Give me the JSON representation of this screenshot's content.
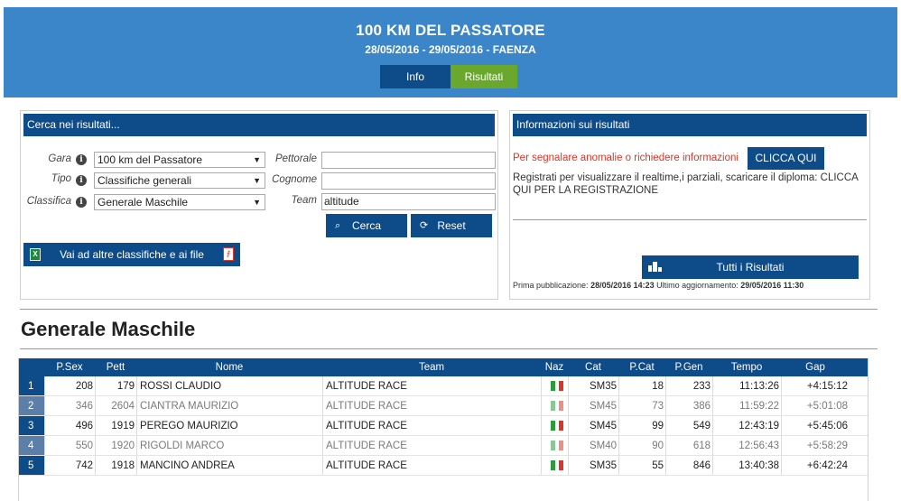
{
  "header": {
    "title": "100 KM DEL PASSATORE",
    "subtitle": "28/05/2016 - 29/05/2016 - FAENZA",
    "tabs": [
      {
        "label": "Info"
      },
      {
        "label": "Risultati"
      }
    ]
  },
  "search": {
    "heading": "Cerca nei risultati...",
    "gara_label": "Gara",
    "gara_value": "100 km del Passatore",
    "tipo_label": "Tipo",
    "tipo_value": "Classifiche generali",
    "classifica_label": "Classifica",
    "classifica_value": "Generale Maschile",
    "pettorale_label": "Pettorale",
    "pettorale_value": "",
    "cognome_label": "Cognome",
    "cognome_value": "",
    "team_label": "Team",
    "team_value": "altitude",
    "cerca_label": "Cerca",
    "reset_label": "Reset",
    "files_label": "Vai ad altre classifiche e ai file"
  },
  "info": {
    "heading": "Informazioni sui risultati",
    "warning": "Per segnalare anomalie o richiedere informazioni",
    "click_label": "CLICCA QUI",
    "register_text": "Registrati per visualizzare il realtime,i parziali, scaricare il diploma: CLICCA QUI PER LA REGISTRAZIONE",
    "all_results_label": "Tutti i Risultati",
    "first_pub_label": "Prima pubblicazione:",
    "first_pub_value": "28/05/2016 14:23",
    "last_update_label": "Ultimo aggiornamento:",
    "last_update_value": "29/05/2016 11:30"
  },
  "section": {
    "title": "Generale Maschile"
  },
  "table": {
    "columns": [
      "P.Sex",
      "Pett",
      "Nome",
      "Team",
      "Naz",
      "Cat",
      "P.Cat",
      "P.Gen",
      "Tempo",
      "Gap"
    ],
    "rows": [
      {
        "rank": "1",
        "psex": "208",
        "pett": "179",
        "nome": "ROSSI CLAUDIO",
        "team": "ALTITUDE RACE",
        "cat": "SM35",
        "pcat": "18",
        "pgen": "233",
        "tempo": "11:13:26",
        "gap": "+4:15:12"
      },
      {
        "rank": "2",
        "psex": "346",
        "pett": "2604",
        "nome": "CIANTRA MAURIZIO",
        "team": "ALTITUDE RACE",
        "cat": "SM45",
        "pcat": "73",
        "pgen": "386",
        "tempo": "11:59:22",
        "gap": "+5:01:08"
      },
      {
        "rank": "3",
        "psex": "496",
        "pett": "1919",
        "nome": "PEREGO MAURIZIO",
        "team": "ALTITUDE RACE",
        "cat": "SM45",
        "pcat": "99",
        "pgen": "549",
        "tempo": "12:43:19",
        "gap": "+5:45:06"
      },
      {
        "rank": "4",
        "psex": "550",
        "pett": "1920",
        "nome": "RIGOLDI MARCO",
        "team": "ALTITUDE RACE",
        "cat": "SM40",
        "pcat": "90",
        "pgen": "618",
        "tempo": "12:56:43",
        "gap": "+5:58:29"
      },
      {
        "rank": "5",
        "psex": "742",
        "pett": "1918",
        "nome": "MANCINO ANDREA",
        "team": "ALTITUDE RACE",
        "cat": "SM35",
        "pcat": "55",
        "pgen": "846",
        "tempo": "13:40:38",
        "gap": "+6:42:24"
      }
    ]
  },
  "colors": {
    "header_bg": "#3a86c8",
    "primary": "#0d4b89",
    "accent": "#6aa82d",
    "warning": "#d9362a"
  },
  "icons": {
    "info": "info-circle-icon",
    "search": "magnifier-icon",
    "reset": "refresh-icon",
    "excel": "excel-icon",
    "pdf": "pdf-icon",
    "podium": "podium-icon",
    "flag": "italy-flag-icon"
  }
}
